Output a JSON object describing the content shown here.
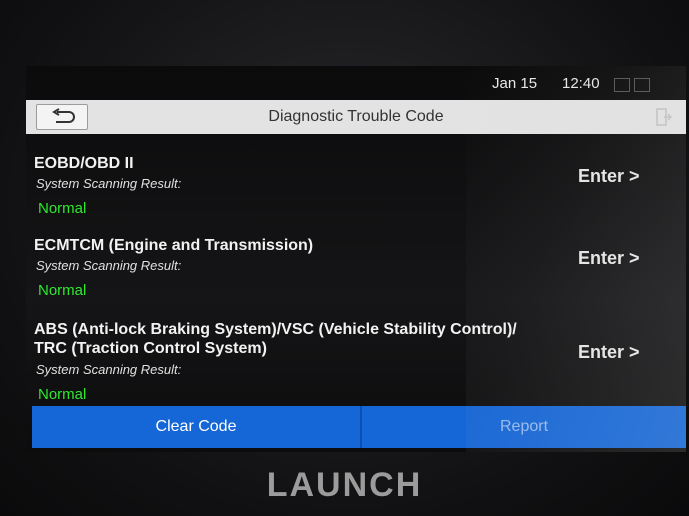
{
  "status": {
    "date": "Jan 15",
    "time": "12:40"
  },
  "header": {
    "title": "Diagnostic Trouble Code"
  },
  "systems": [
    {
      "name": "EOBD/OBD II",
      "result_label": "System Scanning Result:",
      "result": "Normal",
      "action": "Enter >"
    },
    {
      "name": "ECMTCM (Engine and Transmission)",
      "result_label": "System Scanning Result:",
      "result": "Normal",
      "action": "Enter >"
    },
    {
      "name": "ABS (Anti-lock Braking System)/VSC (Vehicle Stability Control)/",
      "name_line2": "TRC (Traction Control System)",
      "result_label": "System Scanning Result:",
      "result": "Normal",
      "action": "Enter >"
    }
  ],
  "footer": {
    "clear_label": "Clear Code",
    "report_label": "Report"
  },
  "device": {
    "brand": "LAUNCH"
  },
  "colors": {
    "accent": "#1566d6",
    "normal_status": "#2ee82e",
    "titlebar": "#e3e3e3"
  }
}
